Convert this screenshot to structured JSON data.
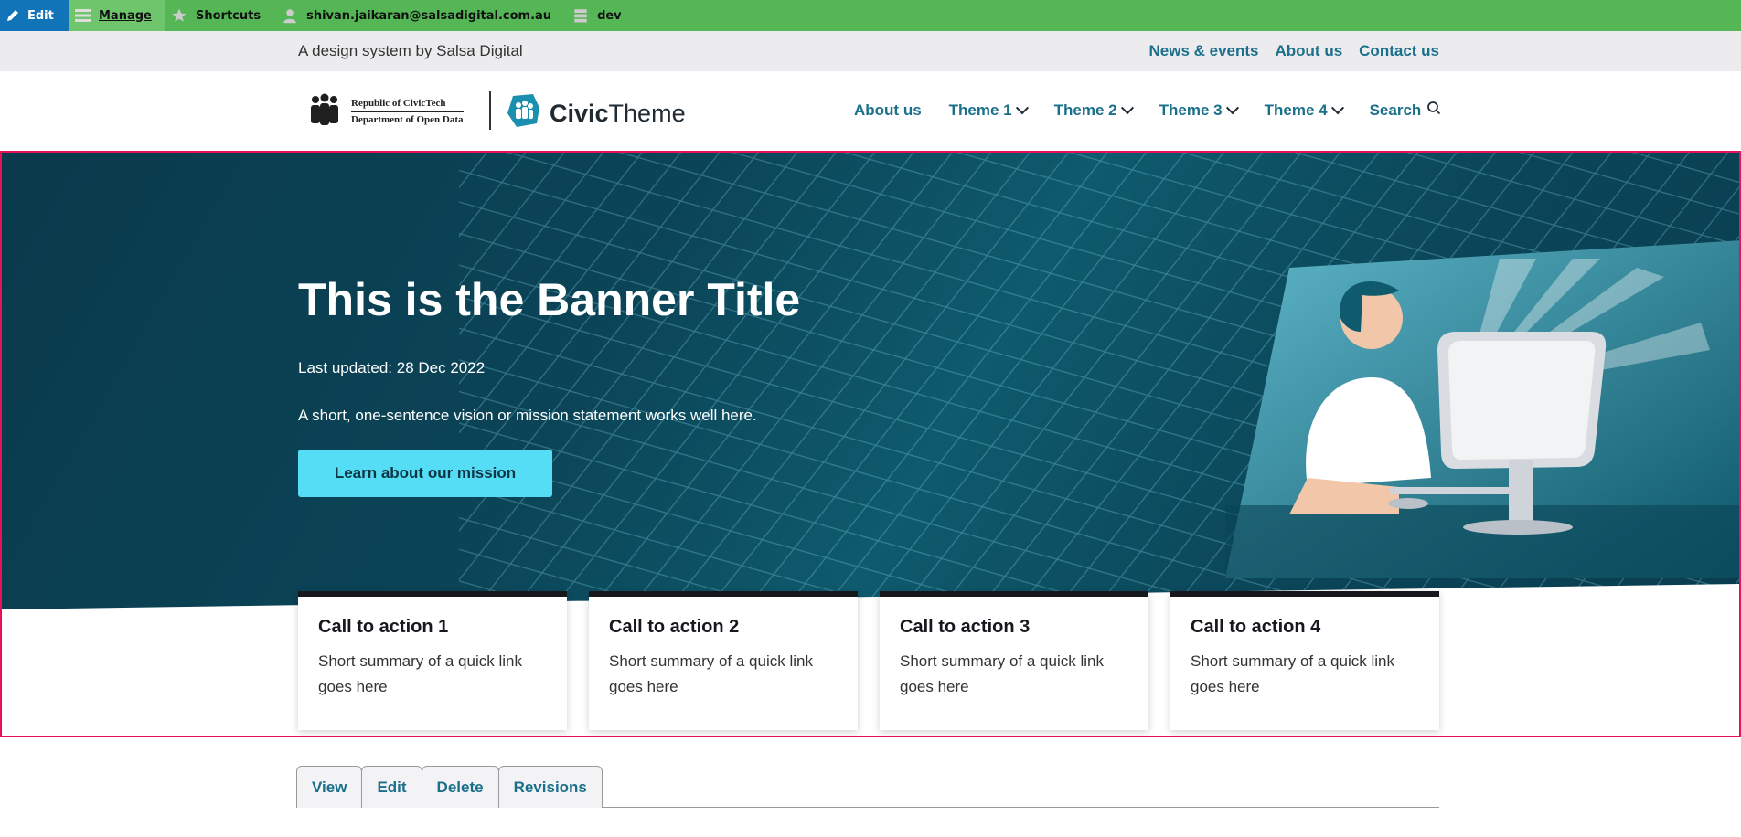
{
  "toolbar": {
    "edit": "Edit",
    "manage": "Manage",
    "shortcuts": "Shortcuts",
    "user": "shivan.jaikaran@salsadigital.com.au",
    "env": "dev"
  },
  "utility": {
    "tagline": "A design system by Salsa Digital",
    "links": [
      "News & events",
      "About us",
      "Contact us"
    ]
  },
  "logo": {
    "gov_line1": "Republic of CivicTech",
    "gov_line2": "Department of Open Data",
    "brand_bold": "Civic",
    "brand_light": "Theme"
  },
  "nav": {
    "items": [
      "About us",
      "Theme 1",
      "Theme 2",
      "Theme 3",
      "Theme 4",
      "Search"
    ]
  },
  "banner": {
    "title": "This is the Banner Title",
    "updated": "Last updated: 28 Dec 2022",
    "summary": "A short, one-sentence vision or mission statement works well here.",
    "button": "Learn about our mission"
  },
  "cards": [
    {
      "title": "Call to action 1",
      "summary": "Short summary of a quick link goes here"
    },
    {
      "title": "Call to action 2",
      "summary": "Short summary of a quick link goes here"
    },
    {
      "title": "Call to action 3",
      "summary": "Short summary of a quick link goes here"
    },
    {
      "title": "Call to action 4",
      "summary": "Short summary of a quick link goes here"
    }
  ],
  "tabs": [
    "View",
    "Edit",
    "Delete",
    "Revisions"
  ],
  "colors": {
    "toolbar": "#55b655",
    "edit_active": "#1173b8",
    "link": "#1a6f8a",
    "banner_dark": "#0a3a4c",
    "button": "#55ddf6",
    "highlight_border": "#e6125a"
  },
  "icons": [
    "pencil-icon",
    "hamburger-icon",
    "star-icon",
    "user-icon",
    "server-icon",
    "chevron-down-icon",
    "search-icon"
  ]
}
